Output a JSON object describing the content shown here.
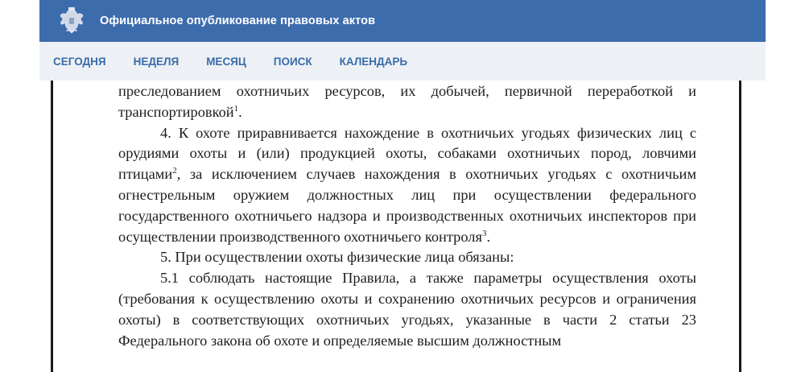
{
  "header": {
    "title": "Официальное опубликование правовых актов",
    "logo_icon": "coat-of-arms-icon"
  },
  "nav": {
    "items": [
      {
        "label": "СЕГОДНЯ"
      },
      {
        "label": "НЕДЕЛЯ"
      },
      {
        "label": "МЕСЯЦ"
      },
      {
        "label": "ПОИСК"
      },
      {
        "label": "КАЛЕНДАРЬ"
      }
    ]
  },
  "document": {
    "p1_text": "преследованием охотничьих ресурсов, их добычей, первичной переработкой и транспортировкой",
    "p1_sup": "1",
    "p2_text_a": "4. К охоте приравнивается нахождение в охотничьих угодьях физических лиц с орудиями охоты и (или) продукцией охоты, собаками охотничьих пород, ловчими птицами",
    "p2_sup_a": "2",
    "p2_text_b": ", за исключением случаев нахождения в охотничьих угодьях с охотничьим огнестрельным оружием должностных лиц при осуществлении федерального государственного охотничьего надзора и производственных охотничьих инспекторов при осуществлении производственного охотничьего контроля",
    "p2_sup_b": "3",
    "p3_text": "5. При осуществлении охоты физические лица обязаны:",
    "p4_text": "5.1 соблюдать настоящие Правила, а также параметры осуществления охоты (требования к осуществлению охоты и сохранению охотничьих ресурсов и ограничения охоты) в соответствующих охотничьих угодьях, указанные в части 2 статьи 23 Федерального закона об охоте и определяемые высшим должностным"
  },
  "colors": {
    "header_bg": "#3d6cad",
    "nav_bg": "#edf1f6",
    "nav_text": "#3a6ca8"
  }
}
